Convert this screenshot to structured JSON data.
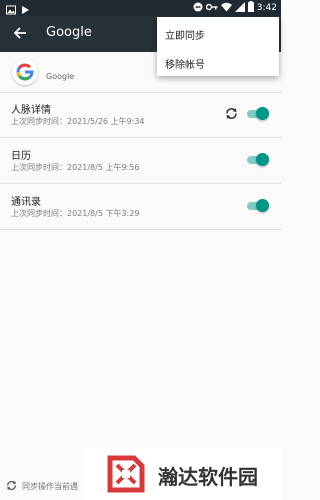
{
  "status_bar": {
    "time": "3:42",
    "icons": [
      "photo-icon",
      "play-icon",
      "minus-circle-icon",
      "key-icon",
      "wifi-icon",
      "signal-icon",
      "battery-icon"
    ]
  },
  "app_bar": {
    "title": "Google",
    "back_icon": "arrow-left-icon"
  },
  "account": {
    "label": "Google",
    "icon": "google-logo-icon"
  },
  "sync_items": [
    {
      "name": "人脉详情",
      "last_sync": "上次同步时间：2021/5/26 上午9:34",
      "enabled": true,
      "syncing": true
    },
    {
      "name": "日历",
      "last_sync": "上次同步时间：2021/8/5 上午9:56",
      "enabled": true,
      "syncing": false
    },
    {
      "name": "通讯录",
      "last_sync": "上次同步时间：2021/8/5 下午3:29",
      "enabled": true,
      "syncing": false
    }
  ],
  "menu": {
    "items": [
      "立即同步",
      "移除帐号"
    ]
  },
  "bottom_notice": "同步操作当前遇",
  "watermark": {
    "text": "瀚达软件园"
  },
  "colors": {
    "app_bar": "#263238",
    "status_bar": "#1f2a32",
    "accent": "#009688",
    "accent_light": "#80cbc4"
  }
}
